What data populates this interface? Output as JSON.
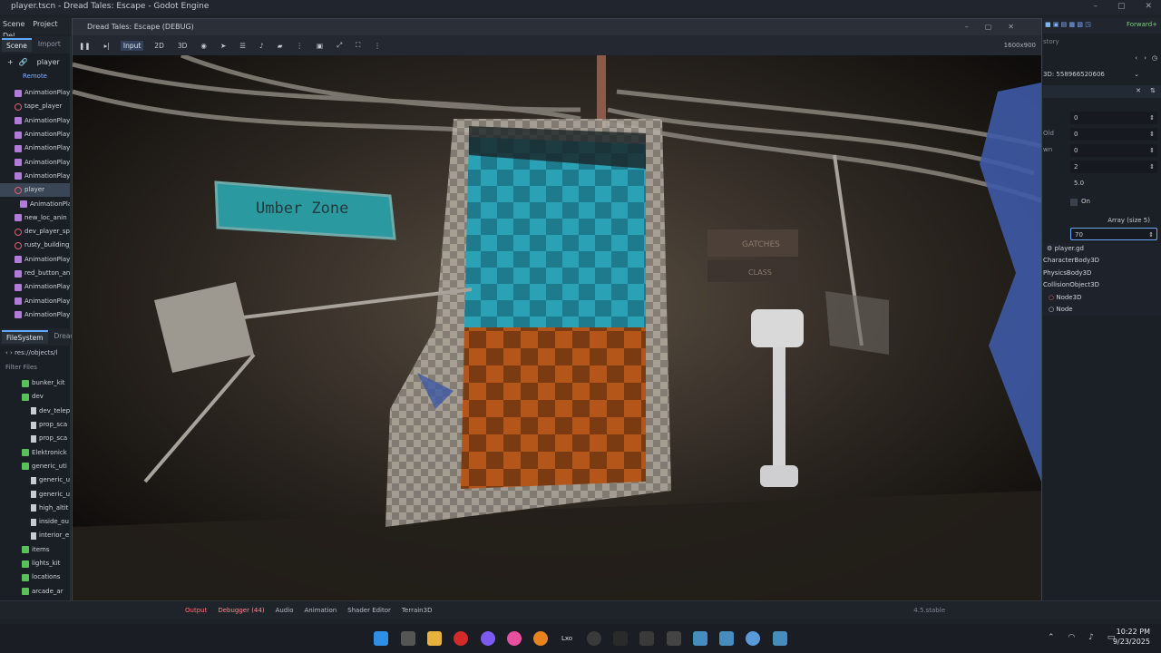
{
  "editor": {
    "title": "player.tscn - Dread Tales: Escape - Godot Engine",
    "menu": [
      "Scene",
      "Project",
      "Del"
    ],
    "renderer": "Forward+"
  },
  "scene_panel": {
    "tabs": [
      "Scene",
      "Import"
    ],
    "root_label": "player",
    "remote_label": "Remote",
    "items": [
      {
        "label": "AnimationPlaye",
        "type": "anim"
      },
      {
        "label": "tape_player",
        "type": "node"
      },
      {
        "label": "AnimationPlaye",
        "type": "anim"
      },
      {
        "label": "AnimationPlaye",
        "type": "anim"
      },
      {
        "label": "AnimationPlaye",
        "type": "anim"
      },
      {
        "label": "AnimationPlaye",
        "type": "anim"
      },
      {
        "label": "AnimationPlaye",
        "type": "anim"
      },
      {
        "label": "player",
        "type": "node",
        "selected": true
      },
      {
        "label": "AnimationPla",
        "type": "anim"
      },
      {
        "label": "new_loc_anin",
        "type": "anim"
      },
      {
        "label": "dev_player_spa",
        "type": "node"
      },
      {
        "label": "rusty_building_",
        "type": "node"
      },
      {
        "label": "AnimationPlaye",
        "type": "anim"
      },
      {
        "label": "red_button_ani",
        "type": "anim"
      },
      {
        "label": "AnimationPlaye",
        "type": "anim"
      },
      {
        "label": "AnimationPlaye",
        "type": "anim"
      },
      {
        "label": "AnimationPlaye",
        "type": "anim"
      }
    ]
  },
  "filesystem_panel": {
    "tabs": [
      "FileSystem",
      "Dread"
    ],
    "path": "res://objects/l",
    "filter_placeholder": "Filter Files",
    "items": [
      {
        "label": "bunker_kit",
        "type": "folder"
      },
      {
        "label": "dev",
        "type": "folder"
      },
      {
        "label": "dev_telep",
        "type": "file"
      },
      {
        "label": "prop_sca",
        "type": "file"
      },
      {
        "label": "prop_sca",
        "type": "file"
      },
      {
        "label": "Elektronick",
        "type": "folder"
      },
      {
        "label": "generic_uti",
        "type": "folder"
      },
      {
        "label": "generic_u",
        "type": "file"
      },
      {
        "label": "generic_u",
        "type": "file"
      },
      {
        "label": "high_altit",
        "type": "file"
      },
      {
        "label": "inside_ou",
        "type": "file"
      },
      {
        "label": "interior_e",
        "type": "file"
      },
      {
        "label": "items",
        "type": "folder"
      },
      {
        "label": "lights_kit",
        "type": "folder"
      },
      {
        "label": "locations",
        "type": "folder"
      },
      {
        "label": "arcade_ar",
        "type": "folder"
      },
      {
        "label": "arcade_mode",
        "type": "folder"
      }
    ]
  },
  "game_window": {
    "title": "Dread Tales: Escape (DEBUG)",
    "resolution": "1600x900",
    "toolbar": {
      "input": "Input",
      "mode_2d": "2D",
      "mode_3d": "3D"
    },
    "scene": {
      "sign_text": "Umber Zone",
      "side_sign_1": "GATCHES",
      "side_sign_2": "CLASS"
    }
  },
  "inspector": {
    "history_label": "story",
    "object_id": "3D: 558966520606",
    "fields": [
      {
        "label": "",
        "value": "0"
      },
      {
        "label": "Old",
        "value": "0"
      },
      {
        "label": "wn",
        "value": "0"
      },
      {
        "label": "",
        "value": "2"
      },
      {
        "label": "",
        "value": "5.0"
      }
    ],
    "toggle_label": "On",
    "array_label": "Array (size 5)",
    "array_input_value": "70",
    "class_tree": [
      "player.gd",
      "CharacterBody3D",
      "PhysicsBody3D",
      "CollisionObject3D",
      "Node3D",
      "Node"
    ]
  },
  "bottom_panel": {
    "tabs": [
      "Output",
      "Debugger (44)",
      "Audio",
      "Animation",
      "Shader Editor",
      "Terrain3D"
    ],
    "version": "4.5.stable"
  },
  "taskbar": {
    "time": "10:22 PM",
    "date": "9/23/2025",
    "app_label": "Lxo"
  }
}
